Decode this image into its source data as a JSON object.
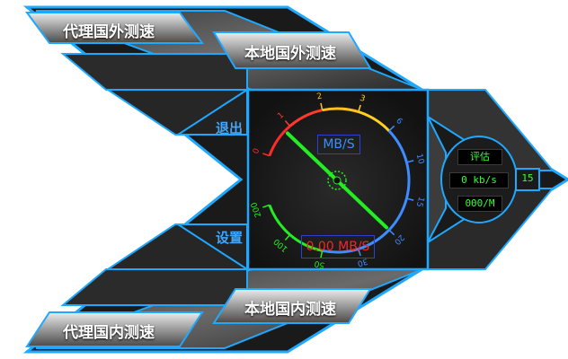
{
  "buttons": {
    "proxy_foreign": "代理国外测速",
    "local_foreign": "本地国外测速",
    "proxy_domestic": "代理国内测速",
    "local_domestic": "本地国内测速",
    "exit": "退出",
    "settings": "设置"
  },
  "gauge": {
    "unit": "MB/S",
    "speed": "0.00 MB/S",
    "ticks": [
      "0",
      "1",
      "2",
      "3",
      "6",
      "10",
      "15",
      "20",
      "30",
      "50",
      "100",
      "200"
    ],
    "needle_value": "20"
  },
  "panel": {
    "rating_label": "评估",
    "speed_value": "0 kb/s",
    "ratio_value": "000/M",
    "side_value": "15"
  },
  "colors": {
    "accent": "#1fa8ff",
    "needle": "#22ee22",
    "speed_text": "#ff2222",
    "unit_text": "#3f8cff"
  }
}
